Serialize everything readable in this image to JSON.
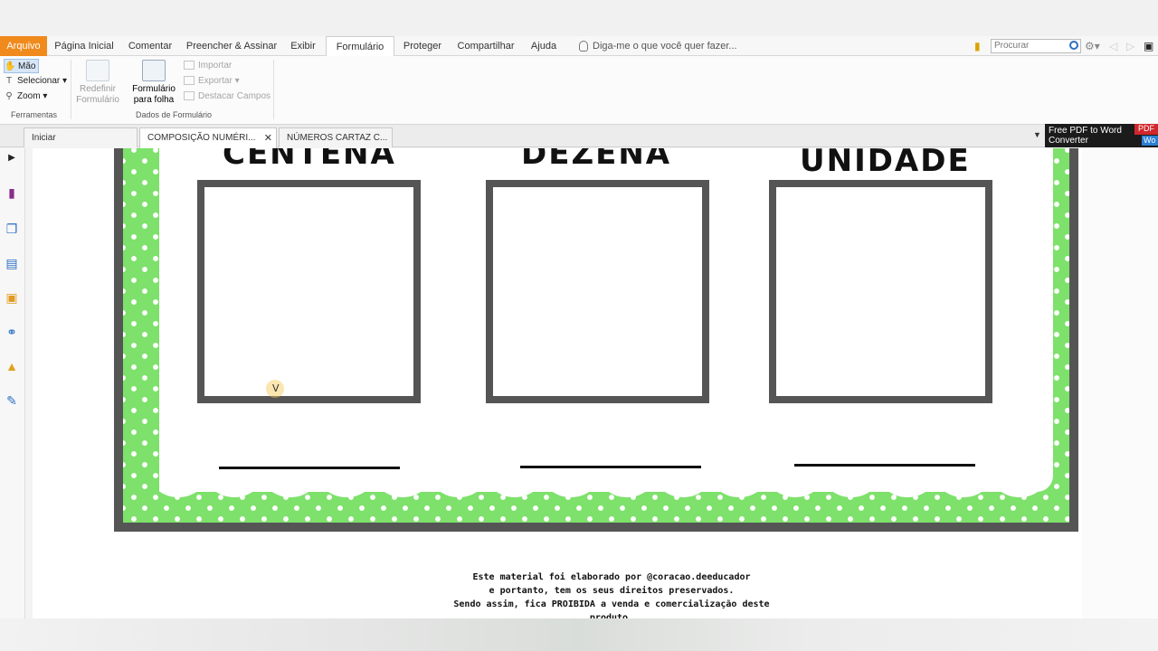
{
  "menu": {
    "tabs": [
      {
        "label": "Arquivo"
      },
      {
        "label": "Página Inicial"
      },
      {
        "label": "Comentar"
      },
      {
        "label": "Preencher & Assinar"
      },
      {
        "label": "Exibir"
      },
      {
        "label": "Formulário"
      },
      {
        "label": "Proteger"
      },
      {
        "label": "Compartilhar"
      },
      {
        "label": "Ajuda"
      }
    ],
    "active_tab": "Formulário",
    "tell_me": "Diga-me o que você quer fazer...",
    "search_placeholder": "Procurar"
  },
  "ribbon": {
    "tools": {
      "hand": "Mão",
      "select": "Selecionar",
      "zoom": "Zoom",
      "group_label": "Ferramentas"
    },
    "reset_form": "Redefinir\nFormulário",
    "form_to_sheet": "Formulário\npara folha",
    "import": "Importar",
    "export": "Exportar",
    "highlight_fields": "Destacar Campos",
    "form_data_group": "Dados de Formulário"
  },
  "doc_tabs": [
    {
      "label": "Iniciar"
    },
    {
      "label": "COMPOSIÇÃO NUMÉRI..."
    },
    {
      "label": "NÚMEROS CARTAZ C..."
    }
  ],
  "ad_banner": {
    "line1": "Free PDF to Word",
    "line2": "Converter",
    "badge_pdf": "PDF",
    "badge_wo": "Wo"
  },
  "document": {
    "headings": [
      "CENTENA",
      "DEZENA",
      "UNIDADE"
    ],
    "footer": [
      "Este material foi elaborado por @coracao.deeducador",
      "e portanto, tem os seus direitos preservados.",
      "Sendo assim, fica PROIBIDA a venda e comercialização deste",
      "produto."
    ]
  },
  "colors": {
    "file_tab": "#f08a1c",
    "green_border": "#7de16b",
    "frame_gray": "#555555"
  }
}
